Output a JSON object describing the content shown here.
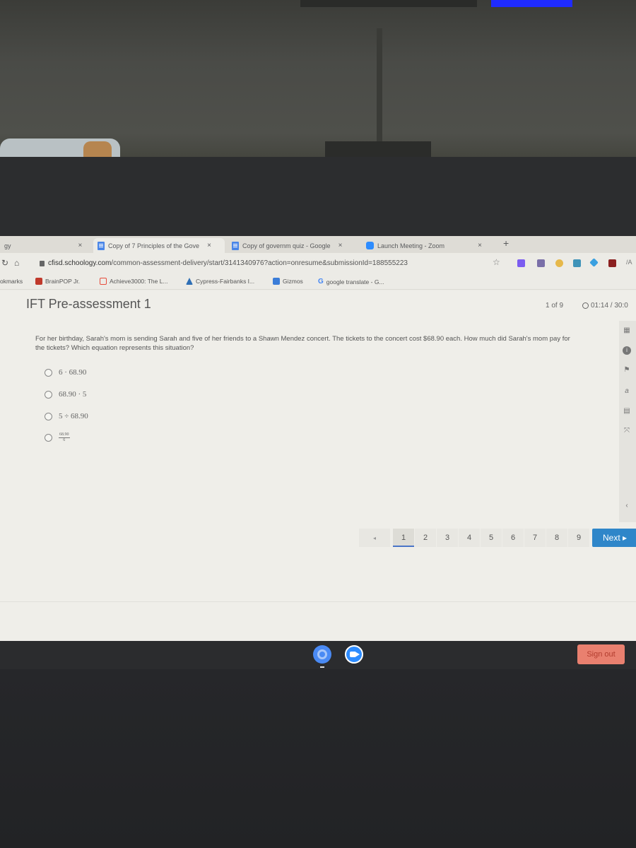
{
  "browser": {
    "tabs": [
      {
        "label": "gy",
        "icon": "none",
        "active": false
      },
      {
        "label": "Copy of 7 Principles of the Gove",
        "icon": "docs-icon",
        "active": true
      },
      {
        "label": "Copy of governm quiz - Google",
        "icon": "docs-icon",
        "active": false
      },
      {
        "label": "Launch Meeting - Zoom",
        "icon": "zoom-icon",
        "active": false
      }
    ],
    "new_tab_label": "+",
    "close_label": "×",
    "url_host": "cfisd.schoology.com",
    "url_path": "/common-assessment-delivery/start/3141340976?action=onresume&submissionId=188555223",
    "star_icon": "☆",
    "ext_text": "/A",
    "bookmarks": [
      {
        "label": "okmarks",
        "icon": "none",
        "color": ""
      },
      {
        "label": "BrainPOP Jr.",
        "icon": "brainpop-icon",
        "color": "#c0392b"
      },
      {
        "label": "Achieve3000: The L...",
        "icon": "achieve-icon",
        "color": "#e74c3c"
      },
      {
        "label": "Cypress-Fairbanks I...",
        "icon": "cfisd-icon",
        "color": "#2f6fb5"
      },
      {
        "label": "Gizmos",
        "icon": "gizmos-icon",
        "color": "#3b7dd8"
      },
      {
        "label": "google translate - G...",
        "icon": "google-icon",
        "color": "#4285f4"
      }
    ]
  },
  "assessment": {
    "title": "IFT Pre-assessment 1",
    "counter": "1 of 9",
    "timer": "01:14 / 30:0",
    "question": "For her birthday, Sarah's mom is sending Sarah and five of her friends to a Shawn Mendez concert.  The tickets to the concert cost $68.90 each.  How much did Sarah's mom pay for the tickets?  Which equation represents this situation?",
    "choices": [
      {
        "label": "6 · 68.90"
      },
      {
        "label": "68.90  · 5"
      },
      {
        "label": "5 ÷ 68.90"
      },
      {
        "numerator": "68.90",
        "denominator": "6"
      }
    ],
    "side_tools": [
      "calendar-icon",
      "info-icon",
      "flag-icon",
      "translate-icon",
      "notepad-icon",
      "expand-icon",
      "collapse-arrow-icon"
    ],
    "pager": {
      "prev_label": "◂",
      "pages": [
        "1",
        "2",
        "3",
        "4",
        "5",
        "6",
        "7",
        "8",
        "9"
      ],
      "current": "1",
      "next_label": "Next ▸"
    }
  },
  "accessibility_bar": {
    "buttons": [
      "undo-icon",
      "magnifier-icon",
      "select-to-speak-icon",
      "move-icon",
      "pause-icon",
      "screenshot-icon"
    ]
  },
  "shelf": {
    "apps": [
      "chrome",
      "zoom"
    ],
    "signout_label": "Sign out"
  }
}
